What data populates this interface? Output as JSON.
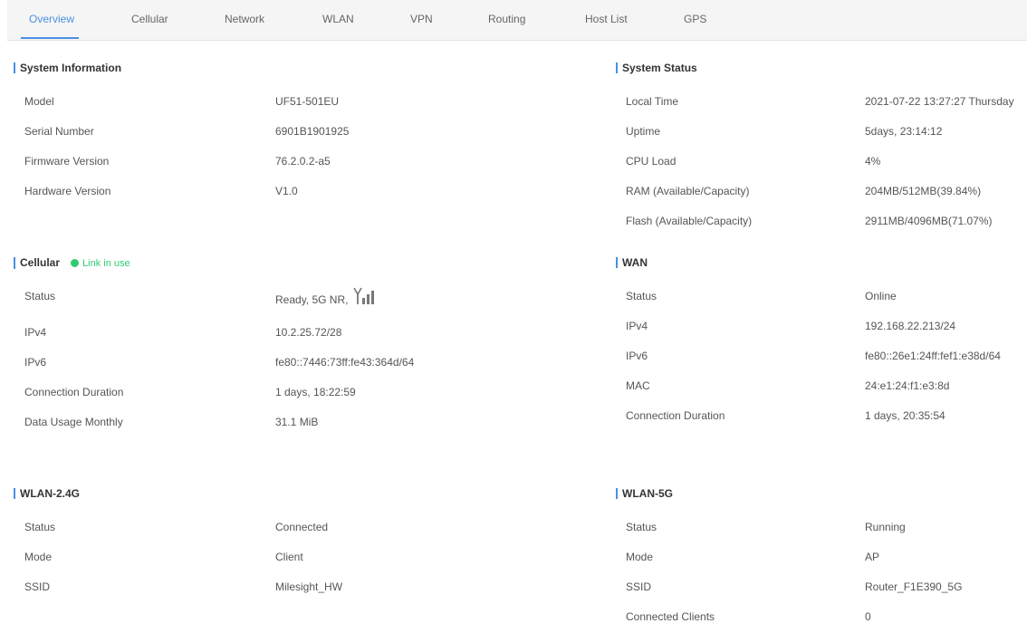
{
  "tabs": [
    "Overview",
    "Cellular",
    "Network",
    "WLAN",
    "VPN",
    "Routing",
    "Host List",
    "GPS"
  ],
  "system_information": {
    "title": "System Information",
    "rows": [
      {
        "label": "Model",
        "value": "UF51-501EU"
      },
      {
        "label": "Serial Number",
        "value": "6901B1901925"
      },
      {
        "label": "Firmware Version",
        "value": "76.2.0.2-a5"
      },
      {
        "label": "Hardware Version",
        "value": "V1.0"
      }
    ]
  },
  "system_status": {
    "title": "System Status",
    "rows": [
      {
        "label": "Local Time",
        "value": "2021-07-22 13:27:27 Thursday"
      },
      {
        "label": "Uptime",
        "value": "5days,  23:14:12"
      },
      {
        "label": "CPU Load",
        "value": "4%"
      },
      {
        "label": "RAM (Available/Capacity)",
        "value": "204MB/512MB(39.84%)"
      },
      {
        "label": "Flash (Available/Capacity)",
        "value": "2911MB/4096MB(71.07%)"
      }
    ]
  },
  "cellular": {
    "title": "Cellular",
    "link_status": "Link in use",
    "rows": [
      {
        "label": "Status",
        "value": "Ready, 5G NR,"
      },
      {
        "label": "IPv4",
        "value": "10.2.25.72/28"
      },
      {
        "label": "IPv6",
        "value": "fe80::7446:73ff:fe43:364d/64"
      },
      {
        "label": "Connection Duration",
        "value": "1 days, 18:22:59"
      },
      {
        "label": "Data Usage Monthly",
        "value": "31.1 MiB"
      }
    ]
  },
  "wan": {
    "title": "WAN",
    "rows": [
      {
        "label": "Status",
        "value": "Online"
      },
      {
        "label": "IPv4",
        "value": "192.168.22.213/24"
      },
      {
        "label": "IPv6",
        "value": "fe80::26e1:24ff:fef1:e38d/64"
      },
      {
        "label": "MAC",
        "value": "24:e1:24:f1:e3:8d"
      },
      {
        "label": "Connection Duration",
        "value": "1 days, 20:35:54"
      }
    ]
  },
  "wlan24": {
    "title": "WLAN-2.4G",
    "rows": [
      {
        "label": "Status",
        "value": "Connected"
      },
      {
        "label": "Mode",
        "value": "Client"
      },
      {
        "label": "SSID",
        "value": "Milesight_HW"
      }
    ]
  },
  "wlan5": {
    "title": "WLAN-5G",
    "rows": [
      {
        "label": "Status",
        "value": "Running"
      },
      {
        "label": "Mode",
        "value": "AP"
      },
      {
        "label": "SSID",
        "value": "Router_F1E390_5G"
      },
      {
        "label": "Connected Clients",
        "value": "0"
      }
    ]
  },
  "colors": {
    "accent": "#4a90e2",
    "link_ok": "#2ecc71"
  }
}
